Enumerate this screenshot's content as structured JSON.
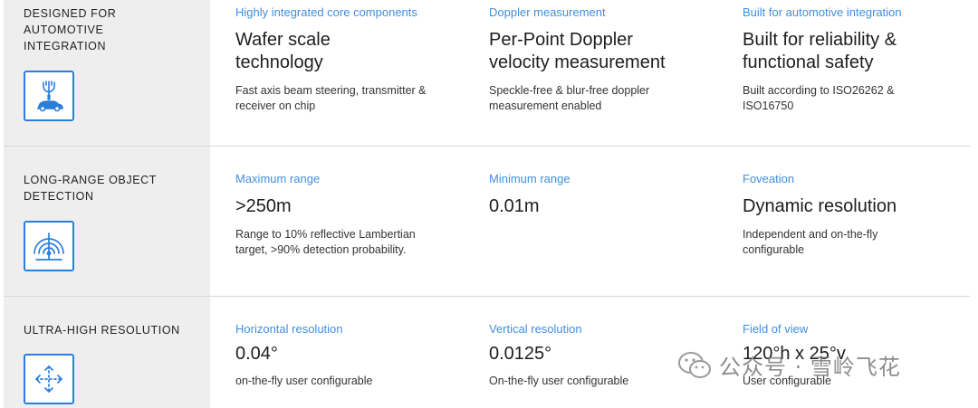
{
  "colors": {
    "accent": "#3f8fe0",
    "icon": "#2b7ed8",
    "sidebar_bg": "#eeeeee"
  },
  "sections": [
    {
      "title": "DESIGNED FOR AUTOMOTIVE INTEGRATION",
      "icon": "antenna-car-icon",
      "specs": [
        {
          "label": "Highly integrated core components",
          "value": "Wafer scale technology",
          "desc": "Fast axis beam steering, transmitter & receiver on chip"
        },
        {
          "label": "Doppler measurement",
          "value": "Per-Point Doppler velocity measurement",
          "desc": "Speckle-free & blur-free doppler measurement enabled"
        },
        {
          "label": "Built for automotive integration",
          "value": "Built for reliability & functional safety",
          "desc": "Built according to ISO26262 & ISO16750"
        }
      ]
    },
    {
      "title": "LONG-RANGE OBJECT DETECTION",
      "icon": "radar-signal-icon",
      "specs": [
        {
          "label": "Maximum range",
          "value": ">250m",
          "desc": "Range to 10% reflective Lambertian target, >90% detection probability."
        },
        {
          "label": "Minimum range",
          "value": "0.01m",
          "desc": ""
        },
        {
          "label": "Foveation",
          "value": "Dynamic resolution",
          "desc": "Independent and on-the-fly configurable"
        }
      ]
    },
    {
      "title": "ULTRA-HIGH RESOLUTION",
      "icon": "expand-arrows-icon",
      "specs": [
        {
          "label": "Horizontal resolution",
          "value": "0.04°",
          "desc": "on-the-fly user configurable"
        },
        {
          "label": "Vertical resolution",
          "value": "0.0125°",
          "desc": "On-the-fly user configurable"
        },
        {
          "label": "Field of view",
          "value": "120°h x 25°v",
          "desc": "User configurable"
        }
      ]
    }
  ],
  "watermark": {
    "text": "公众号 · 雪岭飞花",
    "icon": "wechat-logo-icon"
  }
}
